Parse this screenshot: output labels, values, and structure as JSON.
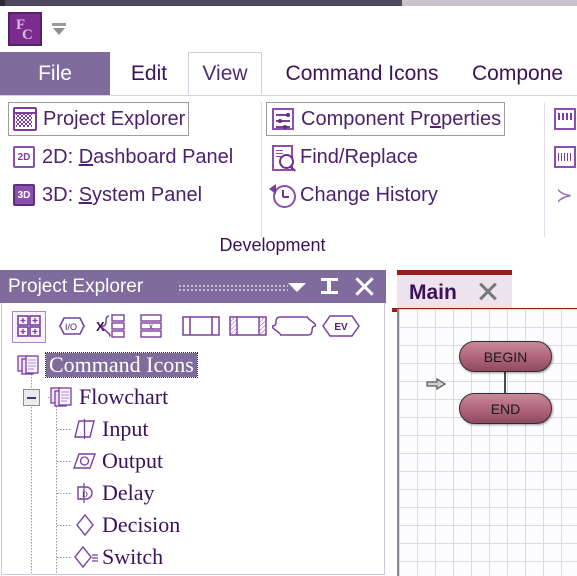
{
  "app": {
    "logo": "fc-logo",
    "quick_access_dropdown": "customize-quick-access-toolbar"
  },
  "ribbon": {
    "tabs": [
      {
        "id": "file",
        "label": "File",
        "active": false,
        "style": "file"
      },
      {
        "id": "edit",
        "label": "Edit",
        "active": false,
        "style": "normal"
      },
      {
        "id": "view",
        "label": "View",
        "active": true,
        "style": "normal"
      },
      {
        "id": "cmdicons",
        "label": "Command Icons",
        "active": false,
        "style": "normal"
      },
      {
        "id": "components",
        "label": "Compone",
        "active": false,
        "style": "normal"
      }
    ],
    "group_title": "Development",
    "items_col1": [
      {
        "id": "project-explorer",
        "label": "Project Explorer",
        "icon": "grid-panel-icon",
        "boxed": true
      },
      {
        "id": "dashboard-panel",
        "label_pre": "2D: ",
        "label_key": "D",
        "label_post": "ashboard Panel",
        "icon": "2d-icon",
        "boxed": false
      },
      {
        "id": "system-panel",
        "label_pre": "3D: ",
        "label_key": "S",
        "label_post": "ystem Panel",
        "icon": "3d-icon",
        "boxed": false
      }
    ],
    "items_col2": [
      {
        "id": "component-properties",
        "label_pre": "Component Pr",
        "label_key": "o",
        "label_post": "perties",
        "icon": "properties-icon",
        "boxed": true
      },
      {
        "id": "find-replace",
        "label": "Find/Replace",
        "icon": "find-replace-icon",
        "boxed": false
      },
      {
        "id": "change-history",
        "label": "Change History",
        "icon": "change-history-icon",
        "boxed": false
      }
    ],
    "items_col3": [
      {
        "id": "digital-scope",
        "icon": "digital-scope-icon"
      },
      {
        "id": "analog-scope",
        "icon": "analog-scope-icon"
      },
      {
        "id": "console",
        "icon": "console-prompt-icon"
      }
    ]
  },
  "project_explorer": {
    "title": "Project Explorer",
    "header_buttons": [
      {
        "id": "menu",
        "name": "panel-menu-button"
      },
      {
        "id": "pin",
        "name": "pin-button"
      },
      {
        "id": "close",
        "name": "close-button"
      }
    ],
    "toolbar": [
      {
        "id": "all-icons",
        "name": "all-icons-button",
        "selected": true
      },
      {
        "id": "io",
        "name": "io-icon-button",
        "selected": false
      },
      {
        "id": "multiplexer",
        "name": "multiplexer-button",
        "selected": false
      },
      {
        "id": "table",
        "name": "table-button",
        "selected": false
      },
      {
        "id": "resistor",
        "name": "resistor-button",
        "selected": false
      },
      {
        "id": "capacitor",
        "name": "capacitor-button",
        "selected": false
      },
      {
        "id": "wave",
        "name": "wave-button",
        "selected": false
      },
      {
        "id": "ev",
        "name": "ev-button",
        "selected": false
      }
    ],
    "tree": [
      {
        "id": "command-icons",
        "label": "Command Icons",
        "depth": 0,
        "icon": "stacked-pages-icon",
        "selected": true,
        "expander": "none"
      },
      {
        "id": "flowchart",
        "label": "Flowchart",
        "depth": 1,
        "icon": "stacked-pages-icon",
        "selected": false,
        "expander": "minus"
      },
      {
        "id": "input",
        "label": "Input",
        "depth": 2,
        "icon": "input-parallelogram-icon",
        "selected": false,
        "expander": "none"
      },
      {
        "id": "output",
        "label": "Output",
        "depth": 2,
        "icon": "output-parallelogram-icon",
        "selected": false,
        "expander": "none"
      },
      {
        "id": "delay",
        "label": "Delay",
        "depth": 2,
        "icon": "delay-icon",
        "selected": false,
        "expander": "none"
      },
      {
        "id": "decision",
        "label": "Decision",
        "depth": 2,
        "icon": "decision-diamond-icon",
        "selected": false,
        "expander": "none"
      },
      {
        "id": "switch",
        "label": "Switch",
        "depth": 2,
        "icon": "switch-diamond-icon",
        "selected": false,
        "expander": "none"
      }
    ]
  },
  "editor": {
    "tab_label": "Main",
    "tab_close": "close-tab-icon",
    "flowchart": {
      "nodes": [
        {
          "id": "begin",
          "label": "BEGIN"
        },
        {
          "id": "end",
          "label": "END"
        }
      ],
      "connector": "begin-to-end-link",
      "pointer": "selection-arrow-cursor"
    }
  },
  "colors": {
    "accent_purple": "#7f6b9c",
    "text_purple": "#3b1259",
    "icon_purple": "#7a3f9e",
    "tab_accent_red": "#9b1c1c",
    "grid_line": "#ddd6ef",
    "node_fill": "#b36a7e"
  }
}
